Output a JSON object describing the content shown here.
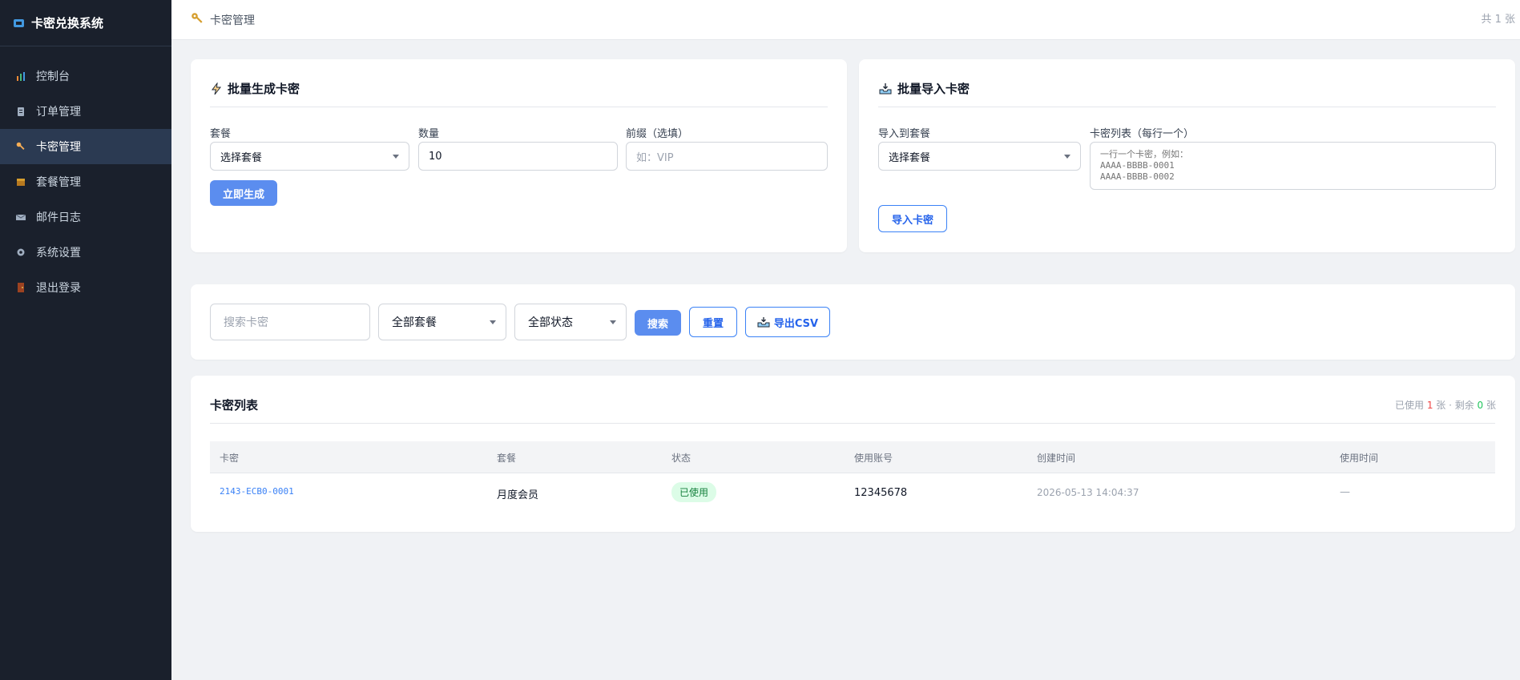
{
  "sidebar": {
    "brand": "卡密兑换系统",
    "items": [
      {
        "label": "控制台",
        "icon": "chart-icon"
      },
      {
        "label": "订单管理",
        "icon": "clipboard-icon"
      },
      {
        "label": "卡密管理",
        "icon": "key-icon",
        "active": true
      },
      {
        "label": "套餐管理",
        "icon": "package-icon"
      },
      {
        "label": "邮件日志",
        "icon": "mail-icon"
      },
      {
        "label": "系统设置",
        "icon": "gear-icon"
      },
      {
        "label": "退出登录",
        "icon": "door-icon"
      }
    ]
  },
  "topbar": {
    "title": "卡密管理",
    "total": "共 1 张"
  },
  "generate": {
    "title": "批量生成卡密",
    "plan_label": "套餐",
    "plan_value": "选择套餐",
    "qty_label": "数量",
    "qty_value": "10",
    "prefix_label": "前缀（选填）",
    "prefix_placeholder": "如：VIP",
    "submit": "立即生成"
  },
  "import": {
    "title": "批量导入卡密",
    "plan_label": "导入到套餐",
    "plan_value": "选择套餐",
    "list_label": "卡密列表（每行一个）",
    "list_placeholder": "一行一个卡密，例如：\nAAAA-BBBB-0001\nAAAA-BBBB-0002",
    "submit": "导入卡密"
  },
  "filter": {
    "search_placeholder": "搜索卡密",
    "plan_select": "全部套餐",
    "status_select": "全部状态",
    "search_btn": "搜索",
    "reset_btn": "重置",
    "export_btn": "导出CSV"
  },
  "list": {
    "title": "卡密列表",
    "stats_prefix": "已使用 ",
    "used_count": "1",
    "stats_mid": " 张 · 剩余 ",
    "remain_count": "0",
    "stats_suffix": " 张",
    "columns": [
      "卡密",
      "套餐",
      "状态",
      "使用账号",
      "创建时间",
      "使用时间"
    ],
    "rows": [
      {
        "code": "2143-ECB0-0001",
        "plan": "月度会员",
        "status": "已使用",
        "account": "12345678",
        "created": "2026-05-13 14:04:37",
        "used": "—"
      }
    ]
  },
  "colors": {
    "sidebar_bg": "#1a202c",
    "active_bg": "#2b3a52",
    "primary": "#5b8def",
    "link": "#2563eb",
    "used_badge_bg": "#dcfce7",
    "used_badge_fg": "#15803d",
    "used_count": "#ef4444",
    "remain_count": "#22c55e"
  }
}
